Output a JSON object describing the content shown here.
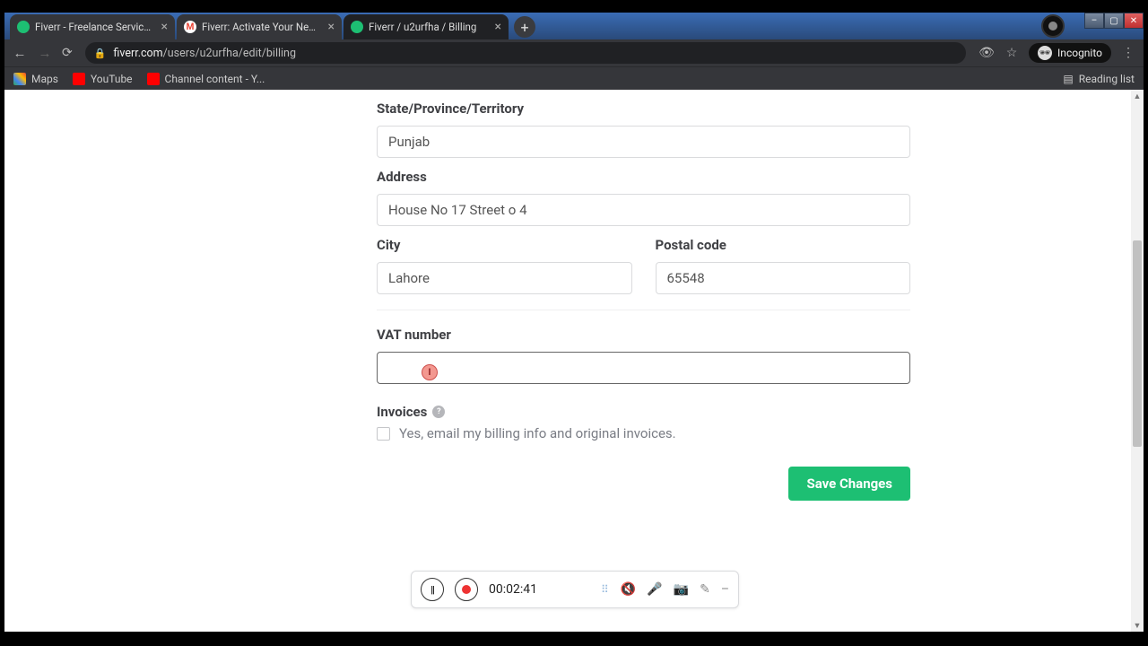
{
  "tabs": [
    {
      "title": "Fiverr - Freelance Services Marke"
    },
    {
      "title": "Fiverr: Activate Your New Accoun"
    },
    {
      "title": "Fiverr / u2urfha / Billing"
    }
  ],
  "url": {
    "domain": "fiverr.com",
    "path": "/users/u2urfha/edit/billing"
  },
  "incognito_label": "Incognito",
  "bookmarks": {
    "maps": "Maps",
    "youtube": "YouTube",
    "channel": "Channel content - Y...",
    "reading": "Reading list"
  },
  "form": {
    "state_label": "State/Province/Territory",
    "state_value": "Punjab",
    "address_label": "Address",
    "address_value": "House No 17 Street o 4",
    "city_label": "City",
    "city_value": "Lahore",
    "postal_label": "Postal code",
    "postal_value": "65548",
    "vat_label": "VAT number",
    "vat_value": "",
    "invoices_heading": "Invoices",
    "invoices_check_label": "Yes, email my billing info and original invoices.",
    "save_button": "Save Changes"
  },
  "recorder": {
    "timer": "00:02:41"
  }
}
